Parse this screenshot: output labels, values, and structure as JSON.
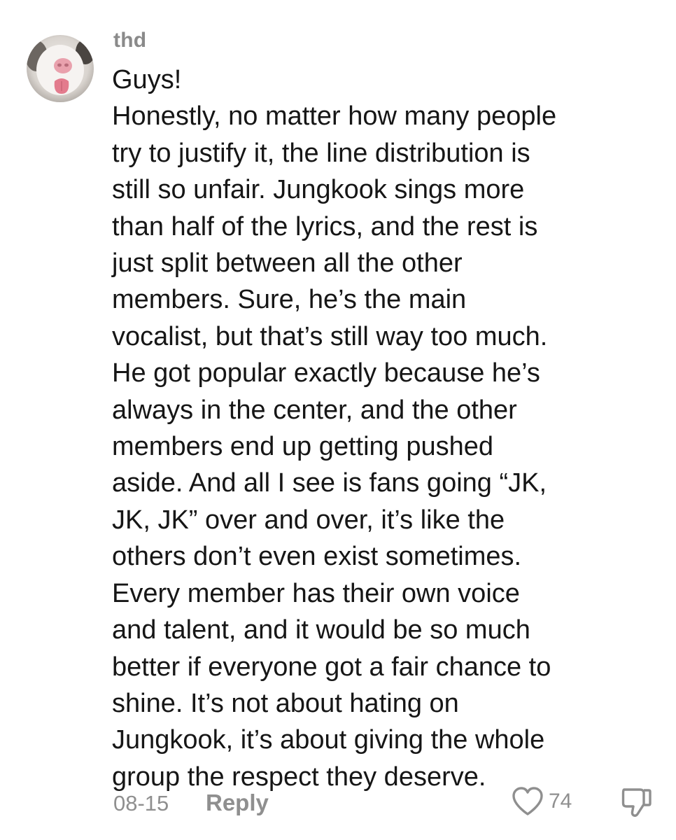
{
  "comment": {
    "username": "thd",
    "body_lines": [
      "Guys!",
      "Honestly, no matter how many people",
      "try to justify it, the line distribution is",
      "still so unfair. Jungkook sings more",
      "than half of the lyrics, and the rest is",
      "just split between all the other",
      "members. Sure, he’s the main",
      "vocalist, but that’s still way too much.",
      "He got popular exactly because he’s",
      "always in the center, and the other",
      "members end up getting pushed",
      "aside. And all I see is fans going “JK,",
      "JK, JK” over and over, it’s like the",
      "others don’t even exist sometimes.",
      "Every member has their own voice",
      "and talent, and it would be so much",
      "better if everyone got a fair chance to",
      "shine. It’s not about hating on",
      "Jungkook, it’s about giving the whole",
      "group the respect they deserve."
    ],
    "date": "08-15",
    "reply_label": "Reply",
    "like_count": "74"
  },
  "icons": {
    "like": "heart-outline-icon",
    "dislike": "thumbs-down-outline-icon",
    "avatar": "user-avatar-photo"
  },
  "colors": {
    "text": "#161616",
    "muted": "#8f8f8f",
    "background": "#ffffff"
  }
}
